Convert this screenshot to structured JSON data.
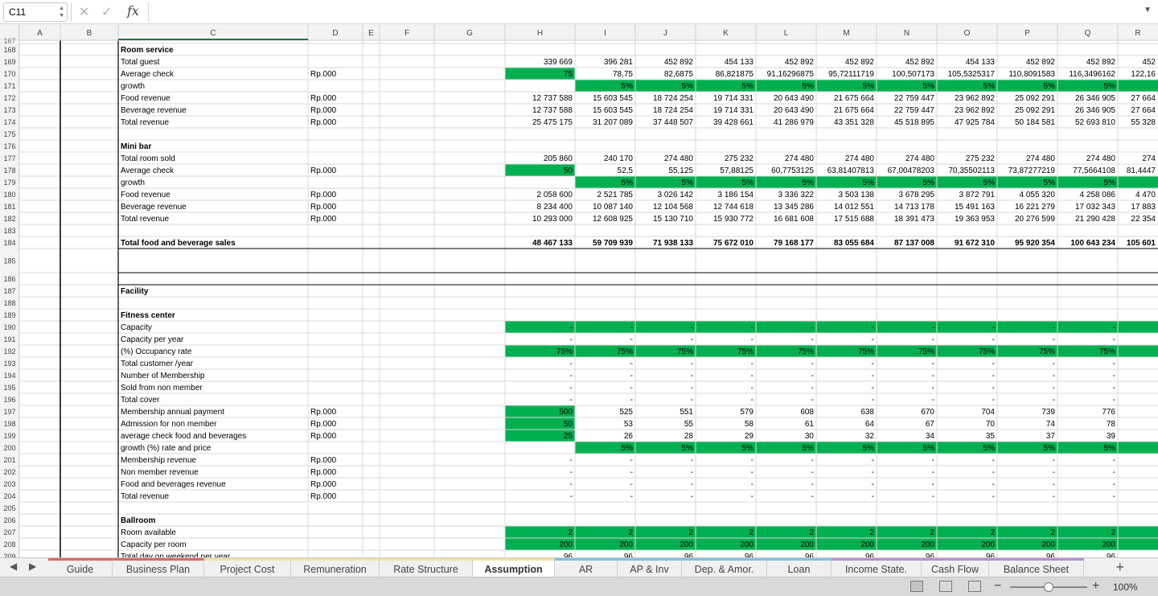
{
  "namebox": "C11",
  "columns": [
    "A",
    "B",
    "C",
    "D",
    "E",
    "F",
    "G",
    "H",
    "I",
    "J",
    "K",
    "L",
    "M",
    "N",
    "O",
    "P",
    "Q",
    "R"
  ],
  "top_row_label": "167",
  "rows": [
    {
      "n": 168,
      "c": "Room service",
      "bold": true
    },
    {
      "n": 169,
      "c": "Total guest",
      "v": [
        "339 669",
        "396 281",
        "452 892",
        "454 133",
        "452 892",
        "452 892",
        "452 892",
        "454 133",
        "452 892",
        "452 892",
        "452"
      ]
    },
    {
      "n": 170,
      "c": "Average check",
      "d": "Rp.000",
      "green": [
        0
      ],
      "v": [
        "75",
        "78,75",
        "82,6875",
        "86,821875",
        "91,16296875",
        "95,72111719",
        "100,507173",
        "105,5325317",
        "110,8091583",
        "116,3496162",
        "122,16"
      ]
    },
    {
      "n": 171,
      "c": "growth",
      "green": [
        1,
        2,
        3,
        4,
        5,
        6,
        7,
        8,
        9,
        10
      ],
      "v": [
        "",
        "5%",
        "5%",
        "5%",
        "5%",
        "5%",
        "5%",
        "5%",
        "5%",
        "5%",
        ""
      ]
    },
    {
      "n": 172,
      "c": "Food revenue",
      "d": "Rp.000",
      "v": [
        "12 737 588",
        "15 603 545",
        "18 724 254",
        "19 714 331",
        "20 643 490",
        "21 675 664",
        "22 759 447",
        "23 962 892",
        "25 092 291",
        "26 346 905",
        "27 664"
      ]
    },
    {
      "n": 173,
      "c": "Beverage revenue",
      "d": "Rp.000",
      "v": [
        "12 737 588",
        "15 603 545",
        "18 724 254",
        "19 714 331",
        "20 643 490",
        "21 675 664",
        "22 759 447",
        "23 962 892",
        "25 092 291",
        "26 346 905",
        "27 664"
      ]
    },
    {
      "n": 174,
      "c": "Total revenue",
      "d": "Rp.000",
      "v": [
        "25 475 175",
        "31 207 089",
        "37 448 507",
        "39 428 661",
        "41 286 979",
        "43 351 328",
        "45 518 895",
        "47 925 784",
        "50 184 581",
        "52 693 810",
        "55 328"
      ]
    },
    {
      "n": 175
    },
    {
      "n": 176,
      "c": "Mini bar",
      "bold": true
    },
    {
      "n": 177,
      "c": "Total room sold",
      "v": [
        "205 860",
        "240 170",
        "274 480",
        "275 232",
        "274 480",
        "274 480",
        "274 480",
        "275 232",
        "274 480",
        "274 480",
        "274"
      ]
    },
    {
      "n": 178,
      "c": "Average check",
      "d": "Rp.000",
      "green": [
        0
      ],
      "v": [
        "50",
        "52,5",
        "55,125",
        "57,88125",
        "60,7753125",
        "63,81407813",
        "67,00478203",
        "70,35502113",
        "73,87277219",
        "77,5664108",
        "81,4447"
      ]
    },
    {
      "n": 179,
      "c": "growth",
      "green": [
        1,
        2,
        3,
        4,
        5,
        6,
        7,
        8,
        9,
        10
      ],
      "v": [
        "",
        "5%",
        "5%",
        "5%",
        "5%",
        "5%",
        "5%",
        "5%",
        "5%",
        "5%",
        ""
      ]
    },
    {
      "n": 180,
      "c": "Food revenue",
      "d": "Rp.000",
      "v": [
        "2 058 600",
        "2 521 785",
        "3 026 142",
        "3 186 154",
        "3 336 322",
        "3 503 138",
        "3 678 295",
        "3 872 791",
        "4 055 320",
        "4 258 086",
        "4 470"
      ]
    },
    {
      "n": 181,
      "c": "Beverage revenue",
      "d": "Rp.000",
      "v": [
        "8 234 400",
        "10 087 140",
        "12 104 568",
        "12 744 618",
        "13 345 286",
        "14 012 551",
        "14 713 178",
        "15 491 163",
        "16 221 279",
        "17 032 343",
        "17 883"
      ]
    },
    {
      "n": 182,
      "c": "Total revenue",
      "d": "Rp.000",
      "v": [
        "10 293 000",
        "12 608 925",
        "15 130 710",
        "15 930 772",
        "16 681 608",
        "17 515 688",
        "18 391 473",
        "19 363 953",
        "20 276 599",
        "21 290 428",
        "22 354"
      ]
    },
    {
      "n": 183
    },
    {
      "n": 184,
      "c": "Total food and beverage sales",
      "bold": true,
      "vbold": true,
      "v": [
        "48 467 133",
        "59 709 939",
        "71 938 133",
        "75 672 010",
        "79 168 177",
        "83 055 684",
        "87 137 008",
        "91 672 310",
        "95 920 354",
        "100 643 234",
        "105 601"
      ]
    },
    {
      "n": 185,
      "tall": true
    },
    {
      "n": 186
    },
    {
      "n": 187,
      "c": "Facility",
      "bold": true
    },
    {
      "n": 188
    },
    {
      "n": 189,
      "c": "Fitness center",
      "bold": true
    },
    {
      "n": 190,
      "c": "Capacity",
      "green": [
        0,
        1,
        2,
        3,
        4,
        5,
        6,
        7,
        8,
        9,
        10
      ],
      "v": [
        "-",
        "-",
        "-",
        "-",
        "-",
        "-",
        "-",
        "-",
        "-",
        "-",
        ""
      ]
    },
    {
      "n": 191,
      "c": "Capacity per year",
      "v": [
        "-",
        "-",
        "-",
        "-",
        "-",
        "-",
        "-",
        "-",
        "-",
        "-",
        ""
      ]
    },
    {
      "n": 192,
      "c": "(%) Occupancy rate",
      "green": [
        0,
        1,
        2,
        3,
        4,
        5,
        6,
        7,
        8,
        9,
        10
      ],
      "v": [
        "75%",
        "75%",
        "75%",
        "75%",
        "75%",
        "75%",
        "75%",
        "75%",
        "75%",
        "75%",
        ""
      ]
    },
    {
      "n": 193,
      "c": "Total customer /year",
      "v": [
        "-",
        "-",
        "-",
        "-",
        "-",
        "-",
        "-",
        "-",
        "-",
        "-",
        ""
      ]
    },
    {
      "n": 194,
      "c": "Number of Membership",
      "v": [
        "-",
        "-",
        "-",
        "-",
        "-",
        "-",
        "-",
        "-",
        "-",
        "-",
        ""
      ]
    },
    {
      "n": 195,
      "c": "Sold from non member",
      "v": [
        "-",
        "-",
        "-",
        "-",
        "-",
        "-",
        "-",
        "-",
        "-",
        "-",
        ""
      ]
    },
    {
      "n": 196,
      "c": "Total cover",
      "v": [
        "-",
        "-",
        "-",
        "-",
        "-",
        "-",
        "-",
        "-",
        "-",
        "-",
        ""
      ]
    },
    {
      "n": 197,
      "c": "Membership annual payment",
      "d": "Rp.000",
      "green": [
        0
      ],
      "v": [
        "500",
        "525",
        "551",
        "579",
        "608",
        "638",
        "670",
        "704",
        "739",
        "776",
        ""
      ]
    },
    {
      "n": 198,
      "c": "Admission for non member",
      "d": "Rp.000",
      "green": [
        0
      ],
      "v": [
        "50",
        "53",
        "55",
        "58",
        "61",
        "64",
        "67",
        "70",
        "74",
        "78",
        ""
      ]
    },
    {
      "n": 199,
      "c": "average check food and beverages",
      "d": "Rp.000",
      "green": [
        0
      ],
      "v": [
        "25",
        "26",
        "28",
        "29",
        "30",
        "32",
        "34",
        "35",
        "37",
        "39",
        ""
      ]
    },
    {
      "n": 200,
      "c": "growth (%) rate and price",
      "green": [
        1,
        2,
        3,
        4,
        5,
        6,
        7,
        8,
        9,
        10
      ],
      "v": [
        "",
        "5%",
        "5%",
        "5%",
        "5%",
        "5%",
        "5%",
        "5%",
        "5%",
        "5%",
        ""
      ]
    },
    {
      "n": 201,
      "c": "Membership revenue",
      "d": "Rp.000",
      "v": [
        "-",
        "-",
        "-",
        "-",
        "-",
        "-",
        "-",
        "-",
        "-",
        "-",
        ""
      ]
    },
    {
      "n": 202,
      "c": "Non member revenue",
      "d": "Rp.000",
      "v": [
        "-",
        "-",
        "-",
        "-",
        "-",
        "-",
        "-",
        "-",
        "-",
        "-",
        ""
      ]
    },
    {
      "n": 203,
      "c": "Food and beverages revenue",
      "d": "Rp.000",
      "v": [
        "-",
        "-",
        "-",
        "-",
        "-",
        "-",
        "-",
        "-",
        "-",
        "-",
        ""
      ]
    },
    {
      "n": 204,
      "c": "Total revenue",
      "d": "Rp.000",
      "v": [
        "-",
        "-",
        "-",
        "-",
        "-",
        "-",
        "-",
        "-",
        "-",
        "-",
        ""
      ]
    },
    {
      "n": 205
    },
    {
      "n": 206,
      "c": "Ballroom",
      "bold": true
    },
    {
      "n": 207,
      "c": "Room available",
      "green": [
        0,
        1,
        2,
        3,
        4,
        5,
        6,
        7,
        8,
        9,
        10
      ],
      "v": [
        "2",
        "2",
        "2",
        "2",
        "2",
        "2",
        "2",
        "2",
        "2",
        "2",
        ""
      ]
    },
    {
      "n": 208,
      "c": "Capacity per room",
      "green": [
        0,
        1,
        2,
        3,
        4,
        5,
        6,
        7,
        8,
        9,
        10
      ],
      "v": [
        "200",
        "200",
        "200",
        "200",
        "200",
        "200",
        "200",
        "200",
        "200",
        "200",
        ""
      ]
    },
    {
      "n": 209,
      "c": "Total day on weekend per year",
      "v": [
        "96",
        "96",
        "96",
        "96",
        "96",
        "96",
        "96",
        "96",
        "96",
        "96",
        ""
      ]
    }
  ],
  "tabs": [
    {
      "label": "Guide",
      "color": "#e06666"
    },
    {
      "label": "Business Plan",
      "color": "#e06666"
    },
    {
      "label": "Project Cost",
      "color": "#f1e49a"
    },
    {
      "label": "Remuneration",
      "color": "#f1e49a"
    },
    {
      "label": "Rate Structure",
      "color": "#f1e49a"
    },
    {
      "label": "Assumption",
      "color": "#f1e49a",
      "active": true
    },
    {
      "label": "AR",
      "color": "#7fbfe6"
    },
    {
      "label": "AP & Inv",
      "color": "#7fbfe6"
    },
    {
      "label": "Dep. & Amor.",
      "color": "#7fbfe6"
    },
    {
      "label": "Loan",
      "color": "#7fbfe6"
    },
    {
      "label": "Income State.",
      "color": "#b48ed1"
    },
    {
      "label": "Cash Flow",
      "color": "#b48ed1"
    },
    {
      "label": "Balance Sheet",
      "color": "#b48ed1"
    }
  ],
  "colors": {
    "green": "#00b050",
    "header_bg": "#f3f3f3",
    "grid_line": "#d9d9d9",
    "selected_col": "#217346"
  },
  "zoom": "100%"
}
